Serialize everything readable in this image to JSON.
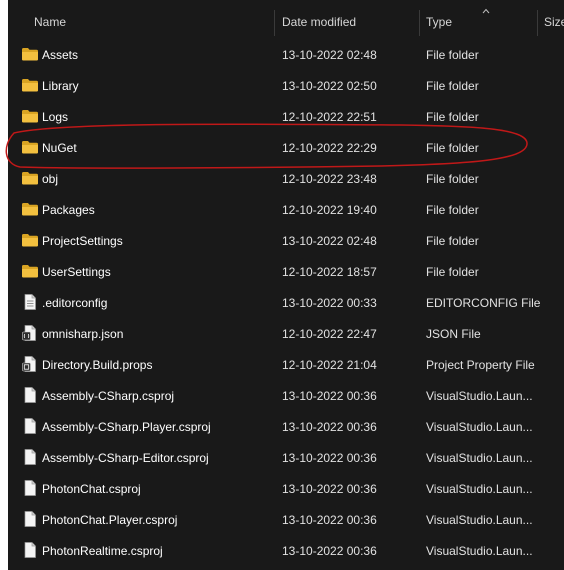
{
  "header": {
    "name": "Name",
    "date_modified": "Date modified",
    "type": "Type",
    "size": "Size"
  },
  "rows": [
    {
      "name": "Assets",
      "date": "13-10-2022 02:48",
      "type": "File folder",
      "icon": "folder-icon"
    },
    {
      "name": "Library",
      "date": "13-10-2022 02:50",
      "type": "File folder",
      "icon": "folder-icon"
    },
    {
      "name": "Logs",
      "date": "12-10-2022 22:51",
      "type": "File folder",
      "icon": "folder-icon"
    },
    {
      "name": "NuGet",
      "date": "12-10-2022 22:29",
      "type": "File folder",
      "icon": "folder-icon"
    },
    {
      "name": "obj",
      "date": "12-10-2022 23:48",
      "type": "File folder",
      "icon": "folder-icon"
    },
    {
      "name": "Packages",
      "date": "12-10-2022 19:40",
      "type": "File folder",
      "icon": "folder-icon"
    },
    {
      "name": "ProjectSettings",
      "date": "13-10-2022 02:48",
      "type": "File folder",
      "icon": "folder-icon"
    },
    {
      "name": "UserSettings",
      "date": "12-10-2022 18:57",
      "type": "File folder",
      "icon": "folder-icon"
    },
    {
      "name": ".editorconfig",
      "date": "13-10-2022 00:33",
      "type": "EDITORCONFIG File",
      "icon": "text-file-icon"
    },
    {
      "name": "omnisharp.json",
      "date": "12-10-2022 22:47",
      "type": "JSON File",
      "icon": "json-file-icon"
    },
    {
      "name": "Directory.Build.props",
      "date": "12-10-2022 21:04",
      "type": "Project Property File",
      "icon": "props-file-icon"
    },
    {
      "name": "Assembly-CSharp.csproj",
      "date": "13-10-2022 00:36",
      "type": "VisualStudio.Laun...",
      "icon": "file-icon"
    },
    {
      "name": "Assembly-CSharp.Player.csproj",
      "date": "13-10-2022 00:36",
      "type": "VisualStudio.Laun...",
      "icon": "file-icon"
    },
    {
      "name": "Assembly-CSharp-Editor.csproj",
      "date": "13-10-2022 00:36",
      "type": "VisualStudio.Laun...",
      "icon": "file-icon"
    },
    {
      "name": "PhotonChat.csproj",
      "date": "13-10-2022 00:36",
      "type": "VisualStudio.Laun...",
      "icon": "file-icon"
    },
    {
      "name": "PhotonChat.Player.csproj",
      "date": "13-10-2022 00:36",
      "type": "VisualStudio.Laun...",
      "icon": "file-icon"
    },
    {
      "name": "PhotonRealtime.csproj",
      "date": "13-10-2022 00:36",
      "type": "VisualStudio.Laun...",
      "icon": "file-icon"
    }
  ],
  "colors": {
    "background": "#191919",
    "folder": "#f3c03f",
    "folder_dark": "#d9a423",
    "annotation": "#c01818"
  }
}
